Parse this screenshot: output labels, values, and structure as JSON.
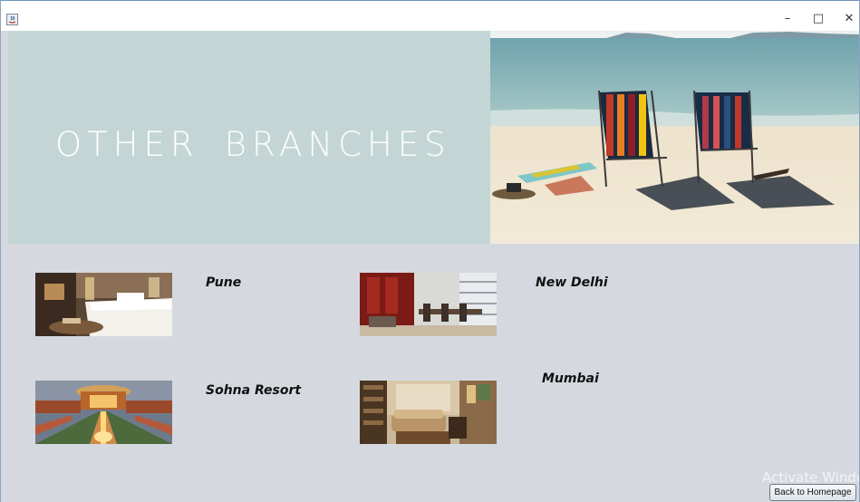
{
  "window": {
    "minimize": "–",
    "maximize": "□",
    "close": "✕"
  },
  "banner": {
    "title_word1": "OTHER",
    "title_word2": "BRANCHES",
    "accent_color": "#c3d6d5"
  },
  "branches": [
    {
      "name": "Pune",
      "image": "hotel-bedroom-image"
    },
    {
      "name": "New Delhi",
      "image": "restaurant-interior-image"
    },
    {
      "name": "Sohna Resort",
      "image": "resort-exterior-image"
    },
    {
      "name": "Mumbai",
      "image": "hotel-lounge-image"
    }
  ],
  "footer": {
    "watermark": "Activate Windo",
    "back_button": "Back to Homepage"
  }
}
